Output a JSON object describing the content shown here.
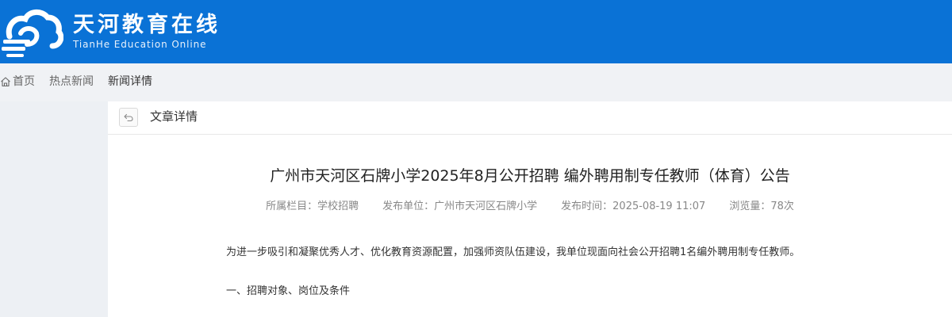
{
  "brand": {
    "title": "天河教育在线",
    "subtitle": "TianHe Education Online",
    "color": "#0a72d6"
  },
  "breadcrumb": {
    "home": "首页",
    "hot_news": "热点新闻",
    "current": "新闻详情"
  },
  "panel": {
    "title": "文章详情"
  },
  "article": {
    "title": "广州市天河区石牌小学2025年8月公开招聘 编外聘用制专任教师（体育）公告",
    "meta": {
      "column": "所属栏目：学校招聘",
      "publisher": "发布单位：广州市天河区石牌小学",
      "time": "发布时间：2025-08-19 11:07",
      "views": "浏览量：78次"
    },
    "paragraphs": [
      "为进一步吸引和凝聚优秀人才、优化教育资源配置，加强师资队伍建设，我单位现面向社会公开招聘1名编外聘用制专任教师。",
      "一、招聘对象、岗位及条件"
    ]
  }
}
